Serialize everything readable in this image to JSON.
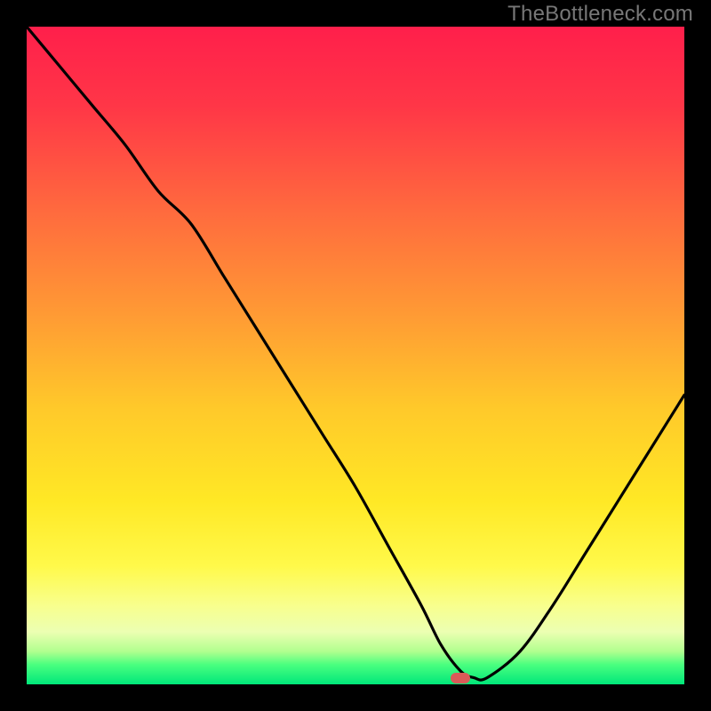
{
  "watermark": "TheBottleneck.com",
  "chart_data": {
    "type": "line",
    "title": "",
    "xlabel": "",
    "ylabel": "",
    "xlim": [
      0,
      100
    ],
    "ylim": [
      0,
      100
    ],
    "x": [
      0,
      5,
      10,
      15,
      20,
      25,
      30,
      35,
      40,
      45,
      50,
      55,
      60,
      63,
      66,
      68,
      70,
      75,
      80,
      85,
      90,
      95,
      100
    ],
    "values": [
      100,
      94,
      88,
      82,
      75,
      70,
      62,
      54,
      46,
      38,
      30,
      21,
      12,
      6,
      2,
      1,
      1,
      5,
      12,
      20,
      28,
      36,
      44
    ],
    "marker": {
      "x": 66,
      "y": 1,
      "color": "#d95a58"
    },
    "gradient_stops": [
      {
        "pct": 0,
        "color": "#ff1f4b"
      },
      {
        "pct": 12,
        "color": "#ff3647"
      },
      {
        "pct": 28,
        "color": "#ff6a3e"
      },
      {
        "pct": 44,
        "color": "#ff9b34"
      },
      {
        "pct": 58,
        "color": "#ffc92a"
      },
      {
        "pct": 72,
        "color": "#ffe825"
      },
      {
        "pct": 82,
        "color": "#fff94a"
      },
      {
        "pct": 88,
        "color": "#f8ff8d"
      },
      {
        "pct": 92,
        "color": "#ecffb2"
      },
      {
        "pct": 95,
        "color": "#b1ff8f"
      },
      {
        "pct": 97,
        "color": "#4aff7f"
      },
      {
        "pct": 100,
        "color": "#00e77a"
      }
    ]
  }
}
